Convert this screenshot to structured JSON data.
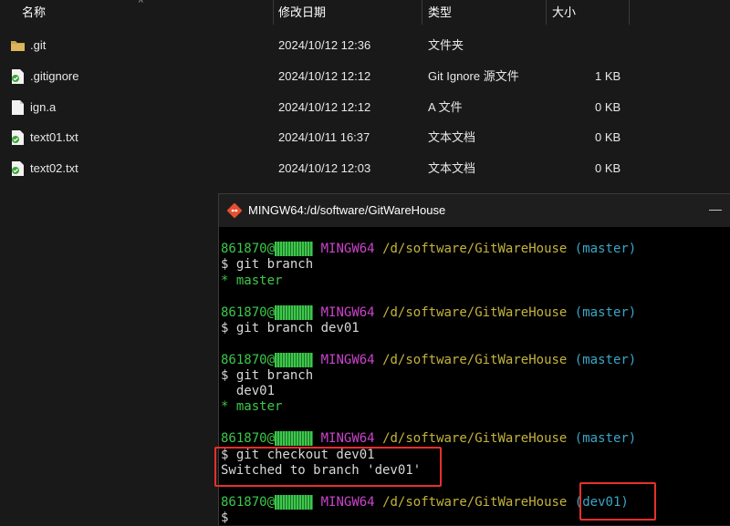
{
  "explorer": {
    "columns": {
      "name": "名称",
      "date": "修改日期",
      "type": "类型",
      "size": "大小"
    },
    "files": [
      {
        "icon": "folder-icon",
        "name": ".git",
        "date": "2024/10/12 12:36",
        "type": "文件夹",
        "size": ""
      },
      {
        "icon": "git-file-icon",
        "name": ".gitignore",
        "date": "2024/10/12 12:12",
        "type": "Git Ignore 源文件",
        "size": "1 KB"
      },
      {
        "icon": "file-icon",
        "name": "ign.a",
        "date": "2024/10/12 12:12",
        "type": "A 文件",
        "size": "0 KB"
      },
      {
        "icon": "git-file-icon",
        "name": "text01.txt",
        "date": "2024/10/11 16:37",
        "type": "文本文档",
        "size": "0 KB"
      },
      {
        "icon": "git-file-icon",
        "name": "text02.txt",
        "date": "2024/10/12 12:03",
        "type": "文本文档",
        "size": "0 KB"
      }
    ]
  },
  "terminal": {
    "title": "MINGW64:/d/software/GitWareHouse",
    "user": "861870",
    "host_env": "MINGW64",
    "path": "/d/software/GitWareHouse",
    "blocks": [
      {
        "branch": "(master)",
        "command": "$ git branch",
        "output": [
          "* master"
        ]
      },
      {
        "branch": "(master)",
        "command": "$ git branch dev01",
        "output": []
      },
      {
        "branch": "(master)",
        "command": "$ git branch",
        "output": [
          "  dev01",
          "* master"
        ]
      },
      {
        "branch": "(master)",
        "command": "$ git checkout dev01",
        "output": [
          "Switched to branch 'dev01'"
        ]
      },
      {
        "branch": "(dev01)",
        "command": "$",
        "output": []
      }
    ]
  }
}
